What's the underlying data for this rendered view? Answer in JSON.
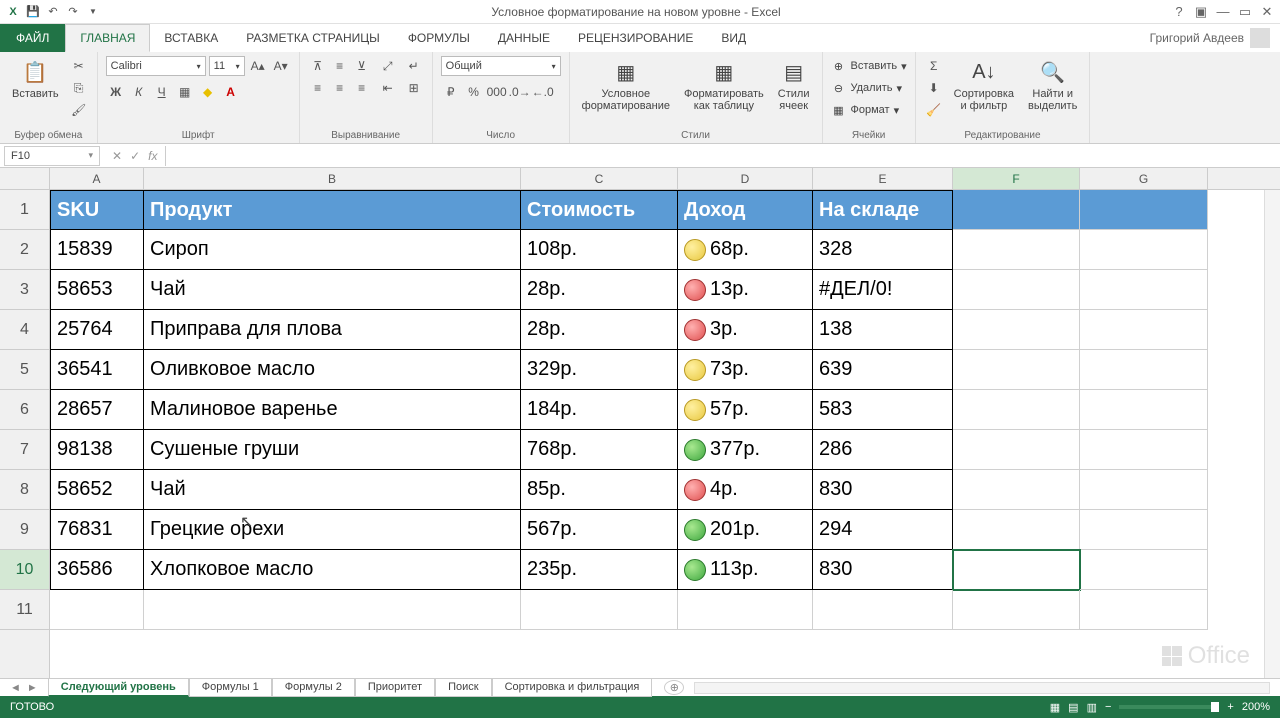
{
  "title": "Условное форматирование на новом уровне - Excel",
  "user": "Григорий Авдеев",
  "name_box": "F10",
  "tabs": {
    "file": "ФАЙЛ",
    "items": [
      "ГЛАВНАЯ",
      "ВСТАВКА",
      "РАЗМЕТКА СТРАНИЦЫ",
      "ФОРМУЛЫ",
      "ДАННЫЕ",
      "РЕЦЕНЗИРОВАНИЕ",
      "ВИД"
    ]
  },
  "ribbon": {
    "clipboard": {
      "paste": "Вставить",
      "label": "Буфер обмена"
    },
    "font": {
      "name": "Calibri",
      "size": "11",
      "label": "Шрифт"
    },
    "align": {
      "label": "Выравнивание"
    },
    "number": {
      "format": "Общий",
      "label": "Число"
    },
    "styles": {
      "cond": "Условное\nформатирование",
      "table": "Форматировать\nкак таблицу",
      "cells": "Стили\nячеек",
      "label": "Стили"
    },
    "cells_g": {
      "insert": "Вставить",
      "delete": "Удалить",
      "format": "Формат",
      "label": "Ячейки"
    },
    "editing": {
      "sort": "Сортировка\nи фильтр",
      "find": "Найти и\nвыделить",
      "label": "Редактирование"
    }
  },
  "columns": [
    "A",
    "B",
    "C",
    "D",
    "E",
    "F",
    "G"
  ],
  "col_widths": [
    "cA",
    "cB",
    "cC",
    "cD",
    "cE",
    "cF",
    "cG"
  ],
  "header_row": [
    "SKU",
    "Продукт",
    "Стоимость",
    "Доход",
    "На складе"
  ],
  "rows": [
    {
      "n": 2,
      "sku": "15839",
      "product": "Сироп",
      "cost": "108р.",
      "icon": "yellow",
      "income": "68р.",
      "stock": "328"
    },
    {
      "n": 3,
      "sku": "58653",
      "product": "Чай",
      "cost": "28р.",
      "icon": "red",
      "income": "13р.",
      "stock": "#ДЕЛ/0!"
    },
    {
      "n": 4,
      "sku": "25764",
      "product": "Приправа для плова",
      "cost": "28р.",
      "icon": "red",
      "income": "3р.",
      "stock": "138"
    },
    {
      "n": 5,
      "sku": "36541",
      "product": "Оливковое масло",
      "cost": "329р.",
      "icon": "yellow",
      "income": "73р.",
      "stock": "639"
    },
    {
      "n": 6,
      "sku": "28657",
      "product": "Малиновое варенье",
      "cost": "184р.",
      "icon": "yellow",
      "income": "57р.",
      "stock": "583"
    },
    {
      "n": 7,
      "sku": "98138",
      "product": "Сушеные груши",
      "cost": "768р.",
      "icon": "green",
      "income": "377р.",
      "stock": "286"
    },
    {
      "n": 8,
      "sku": "58652",
      "product": "Чай",
      "cost": "85р.",
      "icon": "red",
      "income": "4р.",
      "stock": "830"
    },
    {
      "n": 9,
      "sku": "76831",
      "product": "Грецкие орехи",
      "cost": "567р.",
      "icon": "green",
      "income": "201р.",
      "stock": "294"
    },
    {
      "n": 10,
      "sku": "36586",
      "product": "Хлопковое масло",
      "cost": "235р.",
      "icon": "green",
      "income": "113р.",
      "stock": "830"
    }
  ],
  "sheet_tabs": [
    "Следующий уровень",
    "Формулы 1",
    "Формулы 2",
    "Приоритет",
    "Поиск",
    "Сортировка и фильтрация"
  ],
  "status": "ГОТОВО",
  "zoom": "200%",
  "office": "Office"
}
